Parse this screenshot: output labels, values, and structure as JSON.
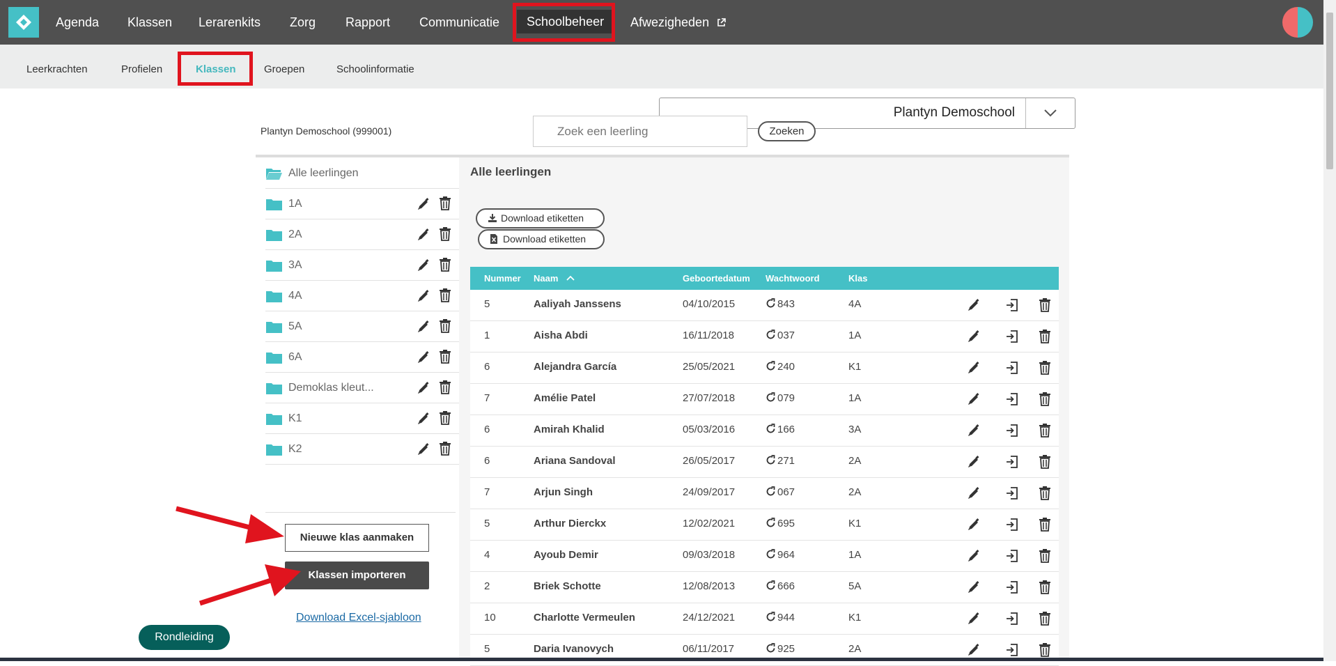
{
  "topnav": {
    "items": [
      "Agenda",
      "Klassen",
      "Lerarenkits",
      "Zorg",
      "Rapport",
      "Communicatie",
      "Schoolbeheer",
      "Afwezigheden"
    ],
    "active": "Schoolbeheer"
  },
  "subnav": {
    "items": [
      "Leerkrachten",
      "Profielen",
      "Klassen",
      "Groepen",
      "Schoolinformatie"
    ],
    "active": "Klassen"
  },
  "school": {
    "label": "Plantyn Demoschool (999001)",
    "selected": "Plantyn Demoschool"
  },
  "search": {
    "placeholder": "Zoek een leerling",
    "button": "Zoeken"
  },
  "classes": {
    "all_label": "Alle leerlingen",
    "items": [
      "1A",
      "2A",
      "3A",
      "4A",
      "5A",
      "6A",
      "Demoklas kleut...",
      "K1",
      "K2"
    ],
    "new_button": "Nieuwe klas aanmaken",
    "import_button": "Klassen importeren",
    "template_link": "Download Excel-sjabloon"
  },
  "tour_button": "Rondleiding",
  "students": {
    "title": "Alle leerlingen",
    "download_label_1": "Download etiketten",
    "download_label_2": "Download etiketten",
    "columns": {
      "number": "Nummer",
      "name": "Naam",
      "birthdate": "Geboortedatum",
      "password": "Wachtwoord",
      "class": "Klas"
    },
    "sort": {
      "column": "Naam",
      "direction": "ascending"
    },
    "rows": [
      {
        "number": "5",
        "name": "Aaliyah Janssens",
        "birthdate": "04/10/2015",
        "password": "843",
        "class": "4A"
      },
      {
        "number": "1",
        "name": "Aisha Abdi",
        "birthdate": "16/11/2018",
        "password": "037",
        "class": "1A"
      },
      {
        "number": "6",
        "name": "Alejandra García",
        "birthdate": "25/05/2021",
        "password": "240",
        "class": "K1"
      },
      {
        "number": "7",
        "name": "Amélie Patel",
        "birthdate": "27/07/2018",
        "password": "079",
        "class": "1A"
      },
      {
        "number": "6",
        "name": "Amirah Khalid",
        "birthdate": "05/03/2016",
        "password": "166",
        "class": "3A"
      },
      {
        "number": "6",
        "name": "Ariana Sandoval",
        "birthdate": "26/05/2017",
        "password": "271",
        "class": "2A"
      },
      {
        "number": "7",
        "name": "Arjun Singh",
        "birthdate": "24/09/2017",
        "password": "067",
        "class": "2A"
      },
      {
        "number": "5",
        "name": "Arthur Dierckx",
        "birthdate": "12/02/2021",
        "password": "695",
        "class": "K1"
      },
      {
        "number": "4",
        "name": "Ayoub Demir",
        "birthdate": "09/03/2018",
        "password": "964",
        "class": "1A"
      },
      {
        "number": "2",
        "name": "Briek Schotte",
        "birthdate": "12/08/2013",
        "password": "666",
        "class": "5A"
      },
      {
        "number": "10",
        "name": "Charlotte Vermeulen",
        "birthdate": "24/12/2021",
        "password": "944",
        "class": "K1"
      },
      {
        "number": "5",
        "name": "Daria Ivanovych",
        "birthdate": "06/11/2017",
        "password": "925",
        "class": "2A"
      }
    ]
  },
  "colors": {
    "accent": "#45c0c6",
    "topbar": "#505050",
    "highlight": "#e0141e",
    "tour": "#065f5a"
  }
}
